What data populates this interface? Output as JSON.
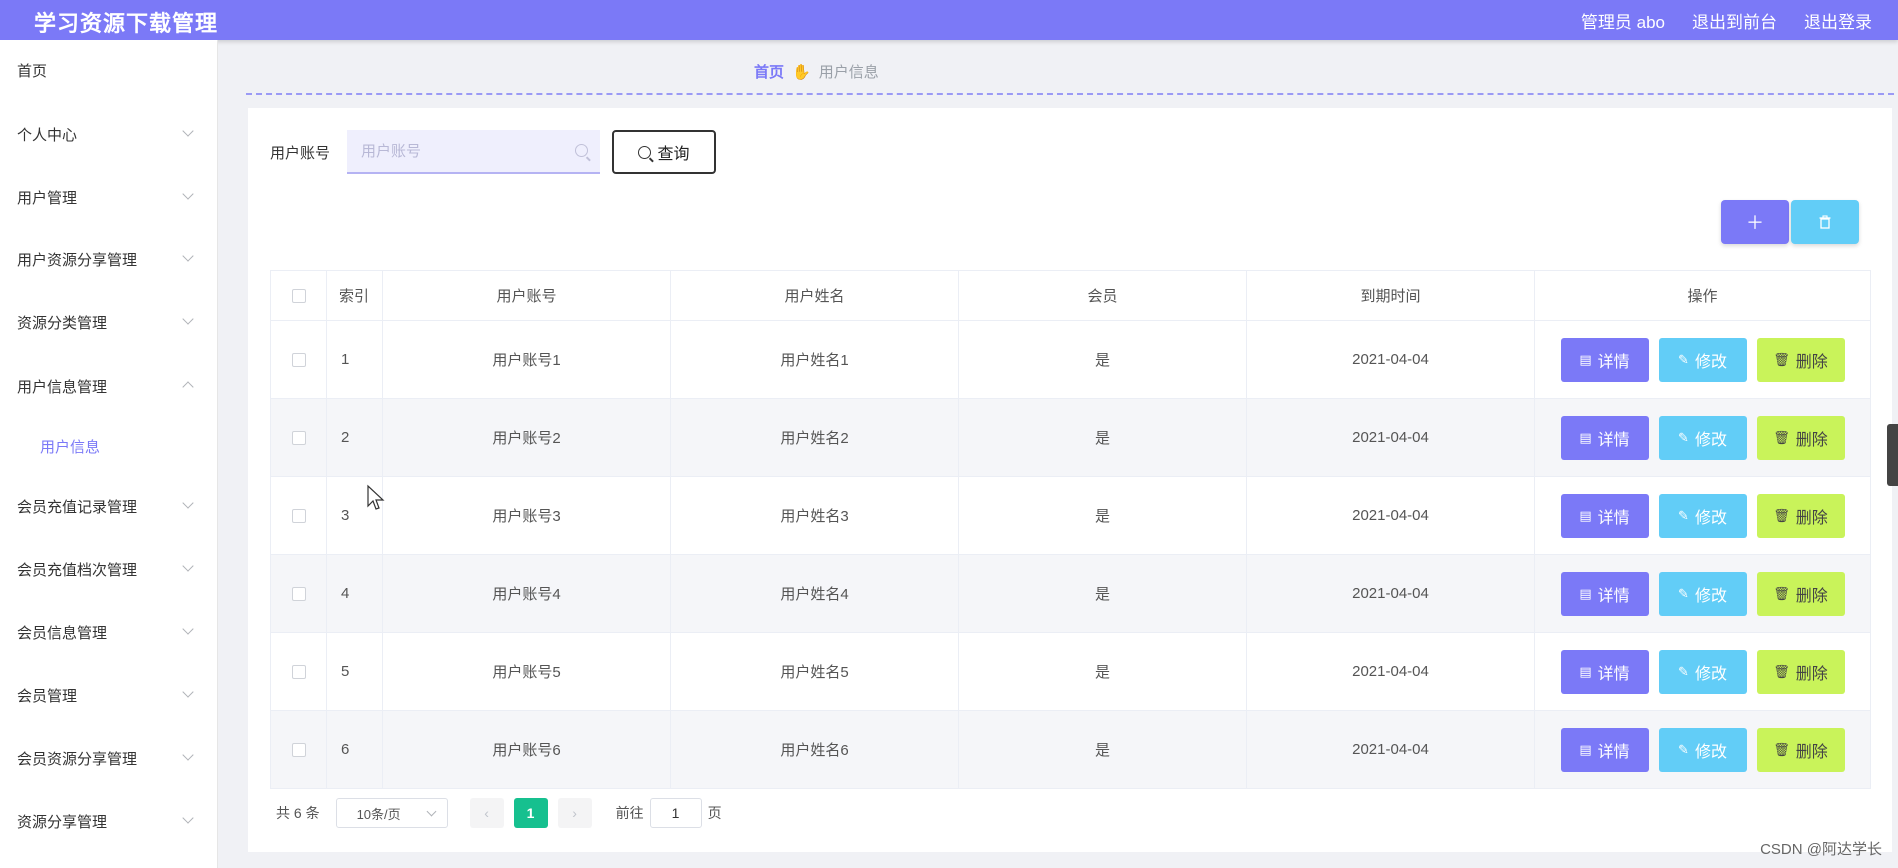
{
  "header": {
    "app_title": "学习资源下载管理",
    "admin_label": "管理员 abo",
    "back_to_front": "退出到前台",
    "logout": "退出登录",
    "accent_color": "#7b79f7"
  },
  "sidebar": {
    "items": [
      {
        "label": "首页"
      },
      {
        "label": "个人中心"
      },
      {
        "label": "用户管理"
      },
      {
        "label": "用户资源分享管理"
      },
      {
        "label": "资源分类管理"
      },
      {
        "label": "用户信息管理"
      },
      {
        "label": "用户信息"
      },
      {
        "label": "会员充值记录管理"
      },
      {
        "label": "会员充值档次管理"
      },
      {
        "label": "会员信息管理"
      },
      {
        "label": "会员管理"
      },
      {
        "label": "会员资源分享管理"
      },
      {
        "label": "资源分享管理"
      }
    ]
  },
  "breadcrumb": {
    "home": "首页",
    "current": "用户信息"
  },
  "search": {
    "label": "用户账号",
    "placeholder": "用户账号",
    "query_label": "查询"
  },
  "toolbar": {
    "add_icon": "plus-icon",
    "delete_icon": "trash-icon"
  },
  "table": {
    "headers": [
      "索引",
      "用户账号",
      "用户姓名",
      "会员",
      "到期时间",
      "操作"
    ],
    "rows": [
      {
        "index": "1",
        "account": "用户账号1",
        "name": "用户姓名1",
        "member": "是",
        "expire": "2021-04-04"
      },
      {
        "index": "2",
        "account": "用户账号2",
        "name": "用户姓名2",
        "member": "是",
        "expire": "2021-04-04"
      },
      {
        "index": "3",
        "account": "用户账号3",
        "name": "用户姓名3",
        "member": "是",
        "expire": "2021-04-04"
      },
      {
        "index": "4",
        "account": "用户账号4",
        "name": "用户姓名4",
        "member": "是",
        "expire": "2021-04-04"
      },
      {
        "index": "5",
        "account": "用户账号5",
        "name": "用户姓名5",
        "member": "是",
        "expire": "2021-04-04"
      },
      {
        "index": "6",
        "account": "用户账号6",
        "name": "用户姓名6",
        "member": "是",
        "expire": "2021-04-04"
      }
    ],
    "actions": {
      "detail": "详情",
      "edit": "修改",
      "delete": "删除"
    }
  },
  "pagination": {
    "total": "共 6 条",
    "page_size": "10条/页",
    "current_page": "1",
    "goto_label": "前往",
    "goto_value": "1",
    "page_suffix": "页"
  },
  "watermark": "CSDN @阿达学长"
}
